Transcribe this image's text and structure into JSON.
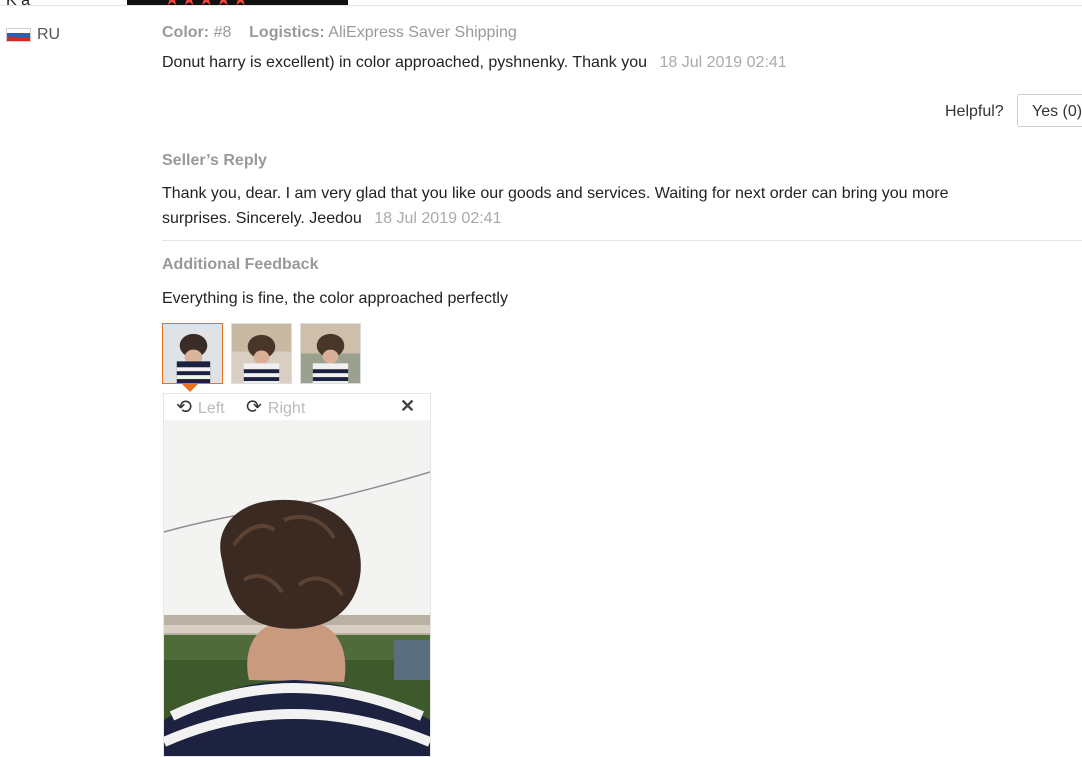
{
  "reviewer": {
    "name": "K  a",
    "stars_label": "★★★★★",
    "country": "RU",
    "flag_colors": [
      "#ffffff",
      "#2f5bbd",
      "#d52b1e"
    ]
  },
  "review": {
    "color_label": "Color:",
    "color_value": "#8",
    "logistics_label": "Logistics:",
    "logistics_value": "AliExpress Saver Shipping",
    "text": "Donut harry is excellent) in color approached, pyshnenky. Thank you",
    "date": "18 Jul 2019 02:41"
  },
  "helpful": {
    "question": "Helpful?",
    "yes_label": "Yes (0)"
  },
  "seller_reply": {
    "title": "Seller’s Reply",
    "text": "Thank you, dear. I am very glad that you like our goods and services. Waiting for next order can bring you more surprises. Sincerely. Jeedou",
    "date": "18 Jul 2019 02:41"
  },
  "additional_feedback": {
    "title": "Additional Feedback",
    "text": "Everything is fine, the color approached perfectly"
  },
  "viewer": {
    "rotate_left_label": "Left",
    "rotate_right_label": "Right",
    "close_icon": "✕",
    "rotate_left_icon": "⟲",
    "rotate_right_icon": "⟳"
  },
  "colors": {
    "accent": "#e8731e",
    "star": "#f0463c",
    "muted": "#999999"
  }
}
